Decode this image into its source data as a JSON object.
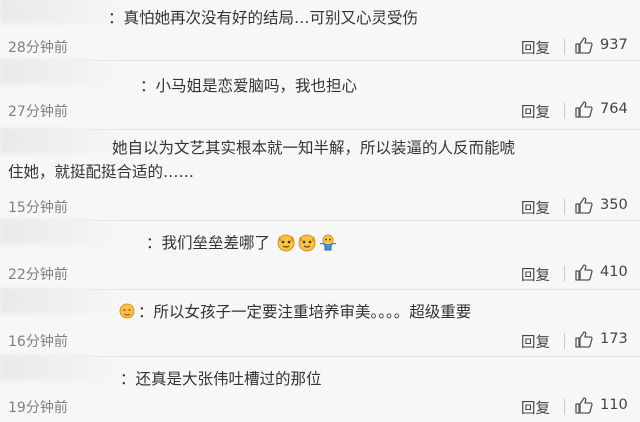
{
  "comments": [
    {
      "text": "：真怕她再次没有好的结局…可别又心灵受伤",
      "time": "28分钟前",
      "reply": "回复",
      "likes": "937"
    },
    {
      "text": "：小马姐是恋爱脑吗，我也担心",
      "time": "27分钟前",
      "reply": "回复",
      "likes": "764"
    },
    {
      "text": "她自以为文艺其实根本就一知半解，所以装逼的人反而能唬住她，就挺配挺合适的……",
      "time": "15分钟前",
      "reply": "回复",
      "likes": "350"
    },
    {
      "text": "：我们垒垒差哪了",
      "time": "22分钟前",
      "reply": "回复",
      "likes": "410"
    },
    {
      "text": "：所以女孩子一定要注重培养审美。。。。超级重要",
      "time": "16分钟前",
      "reply": "回复",
      "likes": "173"
    },
    {
      "text": "：还真是大张伟吐槽过的那位",
      "time": "19分钟前",
      "reply": "回复",
      "likes": "110"
    }
  ],
  "icons": {
    "like": "thumbs-up-icon",
    "emoji_dog": "dog-face-emoji-icon",
    "emoji_shrug": "shrug-emoji-icon",
    "user_badge": "user-badge-icon"
  },
  "colors": {
    "background": "#f7f7f7",
    "text": "#333333",
    "meta": "#808080",
    "divider": "#e4e4e4"
  }
}
